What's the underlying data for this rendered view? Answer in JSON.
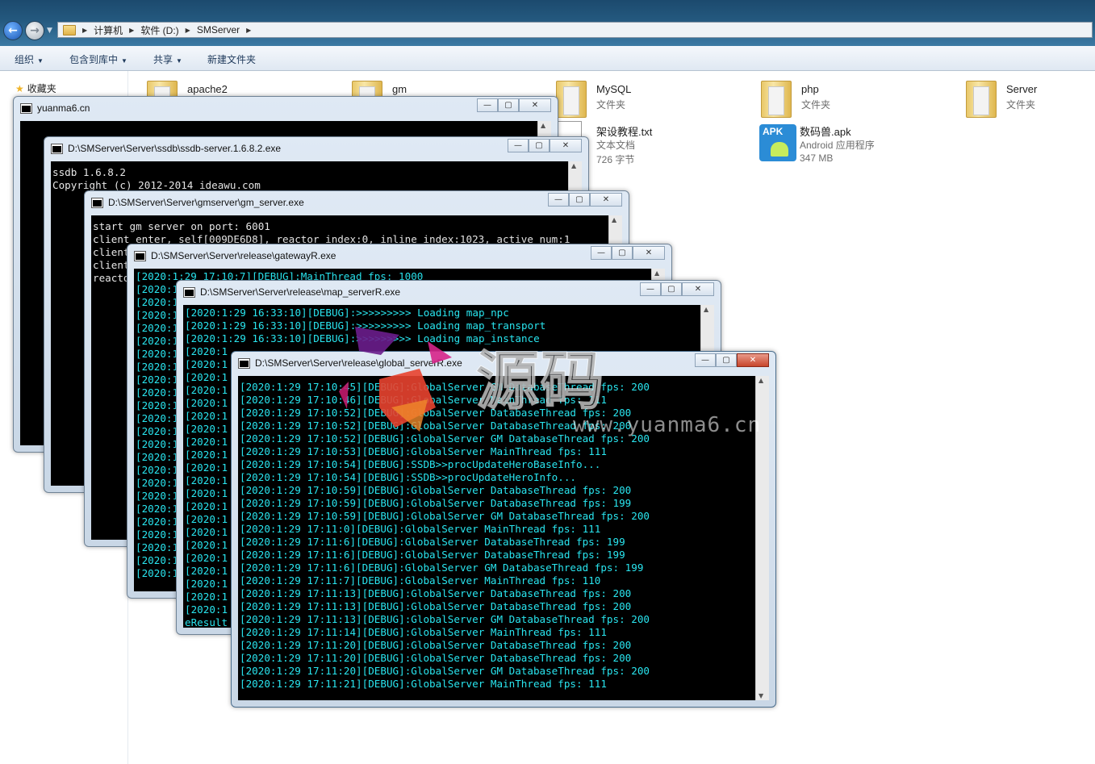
{
  "explorer": {
    "path": [
      "计算机",
      "软件 (D:)",
      "SMServer"
    ],
    "toolbar": {
      "organize": "组织",
      "include": "包含到库中",
      "share": "共享",
      "new_folder": "新建文件夹"
    },
    "favorites": "收藏夹",
    "items": [
      {
        "name": "apache2",
        "sub": ""
      },
      {
        "name": "gm",
        "sub": ""
      },
      {
        "name": "MySQL",
        "sub": "文件夹"
      },
      {
        "name": "php",
        "sub": "文件夹"
      },
      {
        "name": "Server",
        "sub": "文件夹"
      },
      {
        "name": "架设教程.txt",
        "sub": "文本文档",
        "sub2": "726 字节"
      },
      {
        "name": "数码兽.apk",
        "sub": "Android 应用程序",
        "sub2": "347 MB",
        "icon_label": "APK"
      }
    ]
  },
  "windows": {
    "w1": {
      "title": "yuanma6.cn"
    },
    "w2": {
      "title": "D:\\SMServer\\Server\\ssdb\\ssdb-server.1.6.8.2.exe",
      "lines": [
        "ssdb 1.6.8.2",
        "Copyright (c) 2012-2014 ideawu.com"
      ]
    },
    "w3": {
      "title": "D:\\SMServer\\Server\\gmserver\\gm_server.exe",
      "lines": [
        "start gm server on port: 6001",
        "client enter, self[009DE6D8], reactor index:0, inline index:1023, active num:1",
        "client",
        "client",
        "reacto"
      ]
    },
    "w4": {
      "title": "D:\\SMServer\\Server\\release\\gatewayR.exe",
      "lines": [
        "[2020:1:29 17:10:7][DEBUG]:MainThread fps: 1000",
        "[2020:1",
        "[2020:1",
        "[2020:1",
        "[2020:1",
        "[2020:1",
        "[2020:1",
        "[2020:1",
        "[2020:1",
        "[2020:1",
        "[2020:1",
        "[2020:1",
        "[2020:1",
        "[2020:1",
        "[2020:1",
        "[2020:1",
        "[2020:1",
        "[2020:1",
        "[2020:1",
        "[2020:1",
        "[2020:1",
        "[2020:1",
        "[2020:1",
        "[2020:1"
      ]
    },
    "w5": {
      "title": "D:\\SMServer\\Server\\release\\map_serverR.exe",
      "lines": [
        "[2020:1:29 16:33:10][DEBUG]:>>>>>>>>> Loading map_npc",
        "[2020:1:29 16:33:10][DEBUG]:>>>>>>>>> Loading map_transport",
        "[2020:1:29 16:33:10][DEBUG]:>>>>>>>>> Loading map_instance",
        "[2020:1",
        "[2020:1",
        "[2020:1",
        "[2020:1",
        "[2020:1",
        "[2020:1",
        "[2020:1",
        "[2020:1",
        "[2020:1",
        "[2020:1",
        "[2020:1",
        "[2020:1",
        "[2020:1",
        "[2020:1",
        "[2020:1",
        "[2020:1",
        "[2020:1",
        "[2020:1",
        "[2020:1",
        "[2020:1",
        "[2020:1"
      ],
      "last_line": "eResult"
    },
    "w6": {
      "title": "D:\\SMServer\\Server\\release\\global_serverR.exe",
      "lines": [
        "[2020:1:29 17:10:45][DEBUG]:GlobalServer GM DatabaseThread fps: 200",
        "[2020:1:29 17:10:46][DEBUG]:GlobalServer MainThread fps: 111",
        "[2020:1:29 17:10:52][DEBUG]:GlobalServer DatabaseThread fps: 200",
        "[2020:1:29 17:10:52][DEBUG]:GlobalServer DatabaseThread fps: 200",
        "[2020:1:29 17:10:52][DEBUG]:GlobalServer GM DatabaseThread fps: 200",
        "[2020:1:29 17:10:53][DEBUG]:GlobalServer MainThread fps: 111",
        "[2020:1:29 17:10:54][DEBUG]:SSDB>>procUpdateHeroBaseInfo...",
        "[2020:1:29 17:10:54][DEBUG]:SSDB>>procUpdateHeroInfo...",
        "[2020:1:29 17:10:59][DEBUG]:GlobalServer DatabaseThread fps: 200",
        "[2020:1:29 17:10:59][DEBUG]:GlobalServer DatabaseThread fps: 199",
        "[2020:1:29 17:10:59][DEBUG]:GlobalServer GM DatabaseThread fps: 200",
        "[2020:1:29 17:11:0][DEBUG]:GlobalServer MainThread fps: 111",
        "[2020:1:29 17:11:6][DEBUG]:GlobalServer DatabaseThread fps: 199",
        "[2020:1:29 17:11:6][DEBUG]:GlobalServer DatabaseThread fps: 199",
        "[2020:1:29 17:11:6][DEBUG]:GlobalServer GM DatabaseThread fps: 199",
        "[2020:1:29 17:11:7][DEBUG]:GlobalServer MainThread fps: 110",
        "[2020:1:29 17:11:13][DEBUG]:GlobalServer DatabaseThread fps: 200",
        "[2020:1:29 17:11:13][DEBUG]:GlobalServer DatabaseThread fps: 200",
        "[2020:1:29 17:11:13][DEBUG]:GlobalServer GM DatabaseThread fps: 200",
        "[2020:1:29 17:11:14][DEBUG]:GlobalServer MainThread fps: 111",
        "[2020:1:29 17:11:20][DEBUG]:GlobalServer DatabaseThread fps: 200",
        "[2020:1:29 17:11:20][DEBUG]:GlobalServer DatabaseThread fps: 200",
        "[2020:1:29 17:11:20][DEBUG]:GlobalServer GM DatabaseThread fps: 200",
        "[2020:1:29 17:11:21][DEBUG]:GlobalServer MainThread fps: 111"
      ]
    }
  },
  "watermark": {
    "text": "源码",
    "url": "www.yuanma6.cn"
  },
  "colors": {
    "console_cyan": "#29e5ef",
    "console_white": "#e6e6e6",
    "explorer_header": "#24597f"
  }
}
